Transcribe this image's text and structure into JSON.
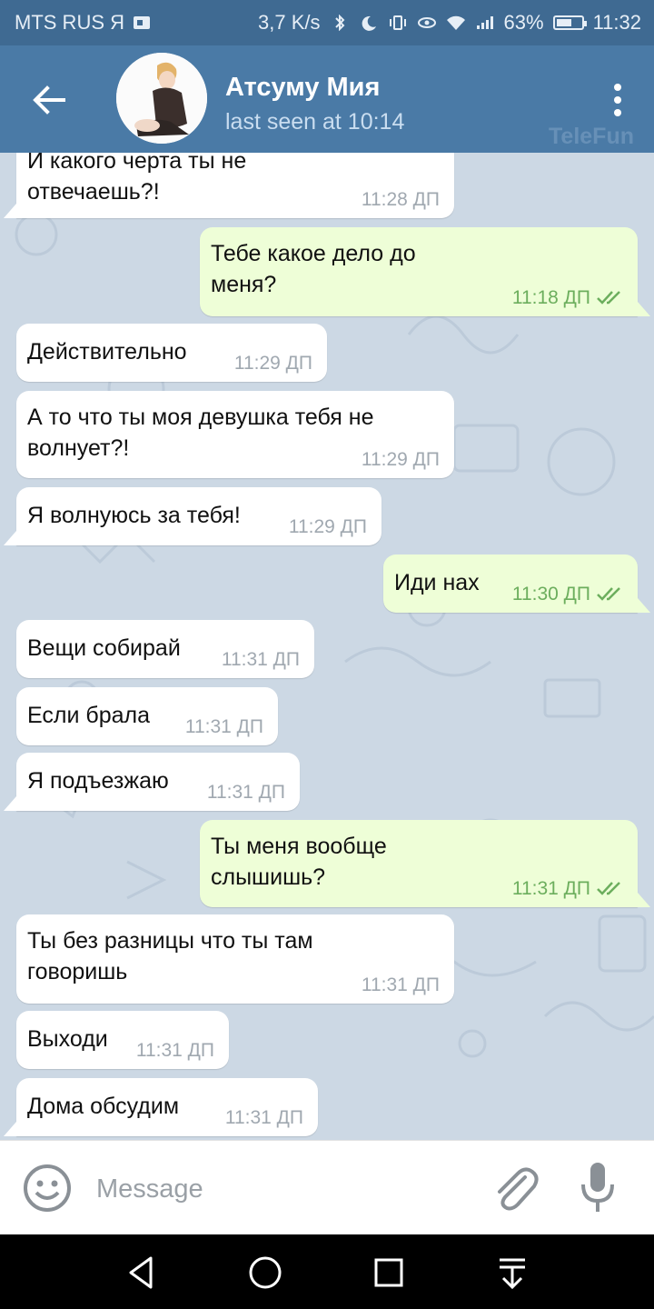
{
  "status_bar": {
    "carrier": "MTS RUS Я",
    "speed": "3,7 K/s",
    "battery": "63%",
    "battery_level": 0.63,
    "time": "11:32"
  },
  "header": {
    "contact_name": "Атсуму Мия",
    "last_seen": "last seen at 10:14",
    "watermark": "TeleFun"
  },
  "messages": [
    {
      "dir": "in",
      "lines": [
        "И какого черта ты не",
        "отвечаешь?!"
      ],
      "time": "11:28 ДП"
    },
    {
      "dir": "out",
      "lines": [
        "Тебе какое дело до",
        "меня?"
      ],
      "time": "11:18 ДП"
    },
    {
      "dir": "in",
      "lines": [
        "Действительно"
      ],
      "time": "11:29 ДП"
    },
    {
      "dir": "in",
      "lines": [
        "А то что ты моя девушка тебя не",
        "волнует?!"
      ],
      "time": "11:29 ДП"
    },
    {
      "dir": "in",
      "lines": [
        "Я волнуюсь за тебя!"
      ],
      "time": "11:29 ДП"
    },
    {
      "dir": "out",
      "lines": [
        "Иди нах"
      ],
      "time": "11:30 ДП"
    },
    {
      "dir": "in",
      "lines": [
        "Вещи собирай"
      ],
      "time": "11:31 ДП"
    },
    {
      "dir": "in",
      "lines": [
        "Если брала"
      ],
      "time": "11:31 ДП"
    },
    {
      "dir": "in",
      "lines": [
        "Я подъезжаю"
      ],
      "time": "11:31 ДП"
    },
    {
      "dir": "out",
      "lines": [
        "Ты меня вообще",
        "слышишь?"
      ],
      "time": "11:31 ДП"
    },
    {
      "dir": "in",
      "lines": [
        "Ты без разницы что ты там",
        "говоришь"
      ],
      "time": "11:31 ДП"
    },
    {
      "dir": "in",
      "lines": [
        "Выходи"
      ],
      "time": "11:31 ДП"
    },
    {
      "dir": "in",
      "lines": [
        "Дома обсудим"
      ],
      "time": "11:31 ДП"
    }
  ],
  "input": {
    "placeholder": "Message"
  },
  "colors": {
    "header_bg": "#4a7aa6",
    "statusbar_bg": "#3f6a92",
    "incoming_bubble": "#ffffff",
    "outgoing_bubble": "#eefed7",
    "read_check": "#6cae5d"
  }
}
